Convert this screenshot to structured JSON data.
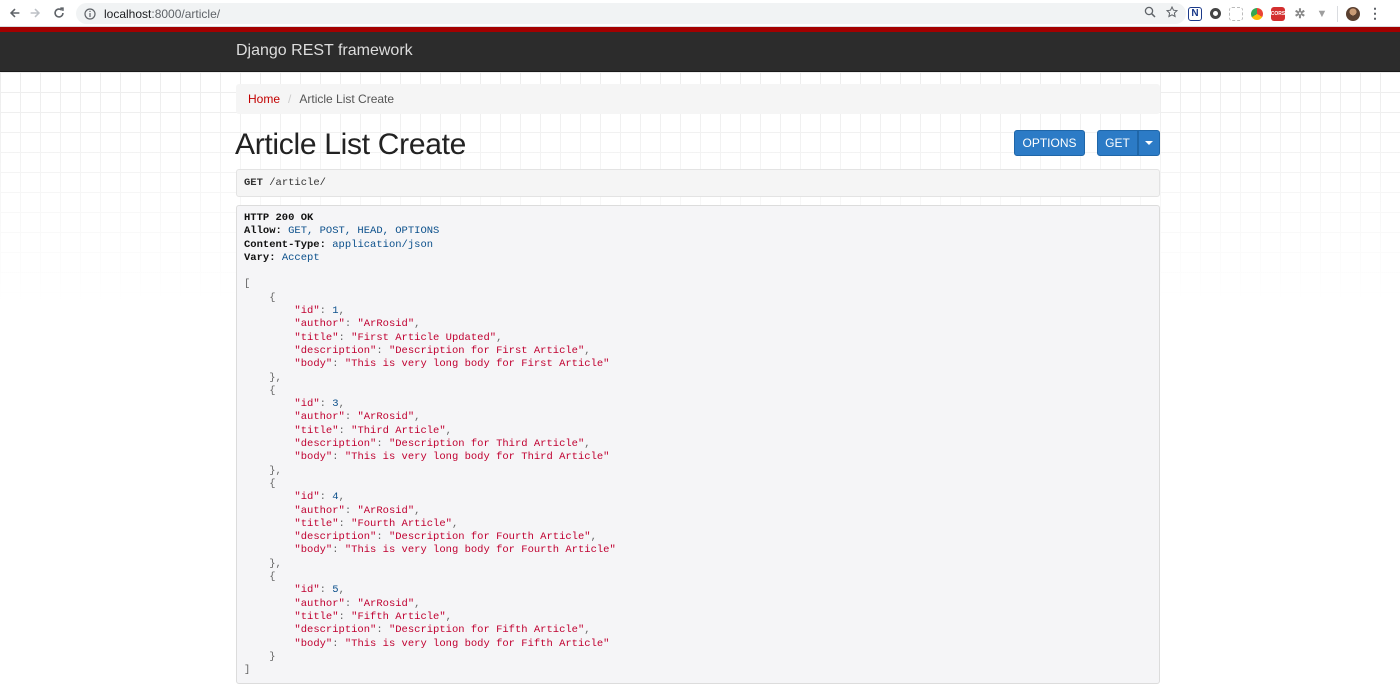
{
  "browser": {
    "url_host": "localhost",
    "url_path": ":8000/article/",
    "ext_n_label": "N",
    "ext_cors_label": "CORS"
  },
  "navbar": {
    "brand": "Django REST framework"
  },
  "breadcrumb": {
    "home": "Home",
    "separator": "/",
    "current": "Article List Create"
  },
  "page": {
    "title": "Article List Create",
    "options_label": "OPTIONS",
    "get_label": "GET"
  },
  "request": {
    "method": "GET",
    "path": "/article/"
  },
  "response": {
    "status": "HTTP 200 OK",
    "headers": [
      {
        "key": "Allow:",
        "value": "GET, POST, HEAD, OPTIONS"
      },
      {
        "key": "Content-Type:",
        "value": "application/json"
      },
      {
        "key": "Vary:",
        "value": "Accept"
      }
    ],
    "articles": [
      {
        "id": "1",
        "author": "\"ArRosid\"",
        "title": "\"First Article Updated\"",
        "description": "\"Description for First Article\"",
        "body": "\"This is very long body for First Article\""
      },
      {
        "id": "3",
        "author": "\"ArRosid\"",
        "title": "\"Third Article\"",
        "description": "\"Description for Third Article\"",
        "body": "\"This is very long body for Third Article\""
      },
      {
        "id": "4",
        "author": "\"ArRosid\"",
        "title": "\"Fourth Article\"",
        "description": "\"Description for Fourth Article\"",
        "body": "\"This is very long body for Fourth Article\""
      },
      {
        "id": "5",
        "author": "\"ArRosid\"",
        "title": "\"Fifth Article\"",
        "description": "\"Description for Fifth Article\"",
        "body": "\"This is very long body for Fifth Article\""
      }
    ],
    "field_keys": [
      "\"id\"",
      "\"author\"",
      "\"title\"",
      "\"description\"",
      "\"body\""
    ]
  }
}
